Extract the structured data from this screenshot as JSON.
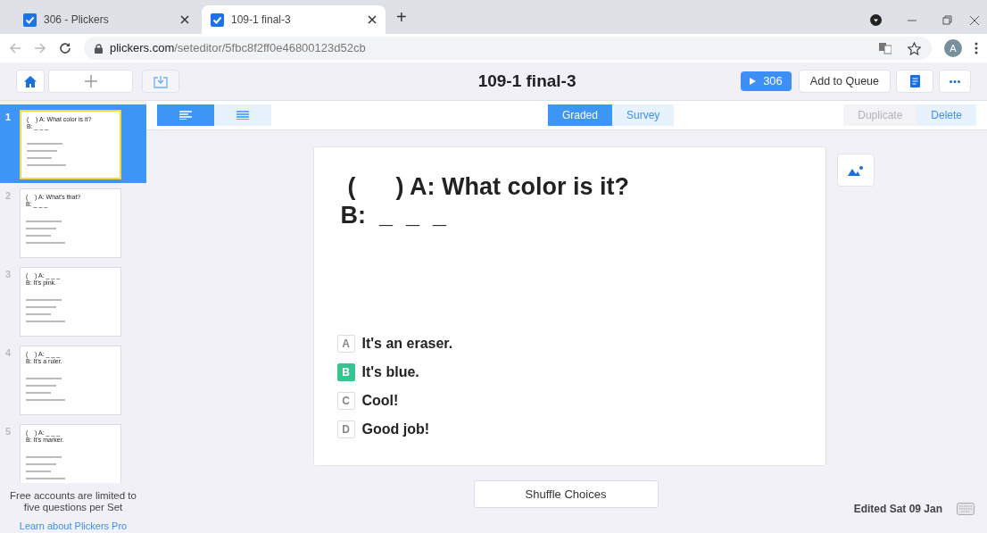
{
  "browser": {
    "tabs": [
      {
        "title": "306 - Plickers",
        "selected": false
      },
      {
        "title": "109-1 final-3",
        "selected": true
      }
    ],
    "new_tab": "+",
    "url_domain": "plickers.com",
    "url_path": "/seteditor/5fbc8f2ff0e46800123d52cb",
    "avatar": "A"
  },
  "header": {
    "title": "109-1 final-3",
    "play_button": "306",
    "queue_button": "Add to Queue"
  },
  "toolbar": {
    "layouts": [
      {
        "selected": true
      },
      {
        "selected": false
      }
    ],
    "modes": [
      {
        "label": "Graded",
        "selected": true
      },
      {
        "label": "Survey",
        "selected": false
      }
    ],
    "actions": [
      {
        "label": "Duplicate",
        "disabled": true
      },
      {
        "label": "Delete",
        "disabled": false
      }
    ]
  },
  "slides": [
    {
      "number": "1",
      "selected": true,
      "line_a": "(    ) A: What color is it?",
      "line_b": "B: _ _ _"
    },
    {
      "number": "2",
      "selected": false,
      "line_a": "(    ) A: What's that?",
      "line_b": "B: _ _ _"
    },
    {
      "number": "3",
      "selected": false,
      "line_a": "(    ) A: _ _ _",
      "line_b": "B: It's pink."
    },
    {
      "number": "4",
      "selected": false,
      "line_a": "(    ) A: _ _ _",
      "line_b": "B: It's a ruler."
    },
    {
      "number": "5",
      "selected": false,
      "line_a": "(    ) A: _ _ _",
      "line_b": "B: It's marker."
    }
  ],
  "question": {
    "line_a": "(      ) A: What color is it?",
    "line_b": "B:  _  _  _",
    "choices": [
      {
        "letter": "A",
        "text": "It's an eraser.",
        "correct": false
      },
      {
        "letter": "B",
        "text": "It's blue.",
        "correct": true
      },
      {
        "letter": "C",
        "text": "Cool!",
        "correct": false
      },
      {
        "letter": "D",
        "text": "Good job!",
        "correct": false
      }
    ]
  },
  "sidebar_footer": {
    "notice": "Free accounts are limited to five questions per Set",
    "link": "Learn about Plickers Pro"
  },
  "shuffle_button": "Shuffle Choices",
  "edited": "Edited Sat 09 Jan"
}
